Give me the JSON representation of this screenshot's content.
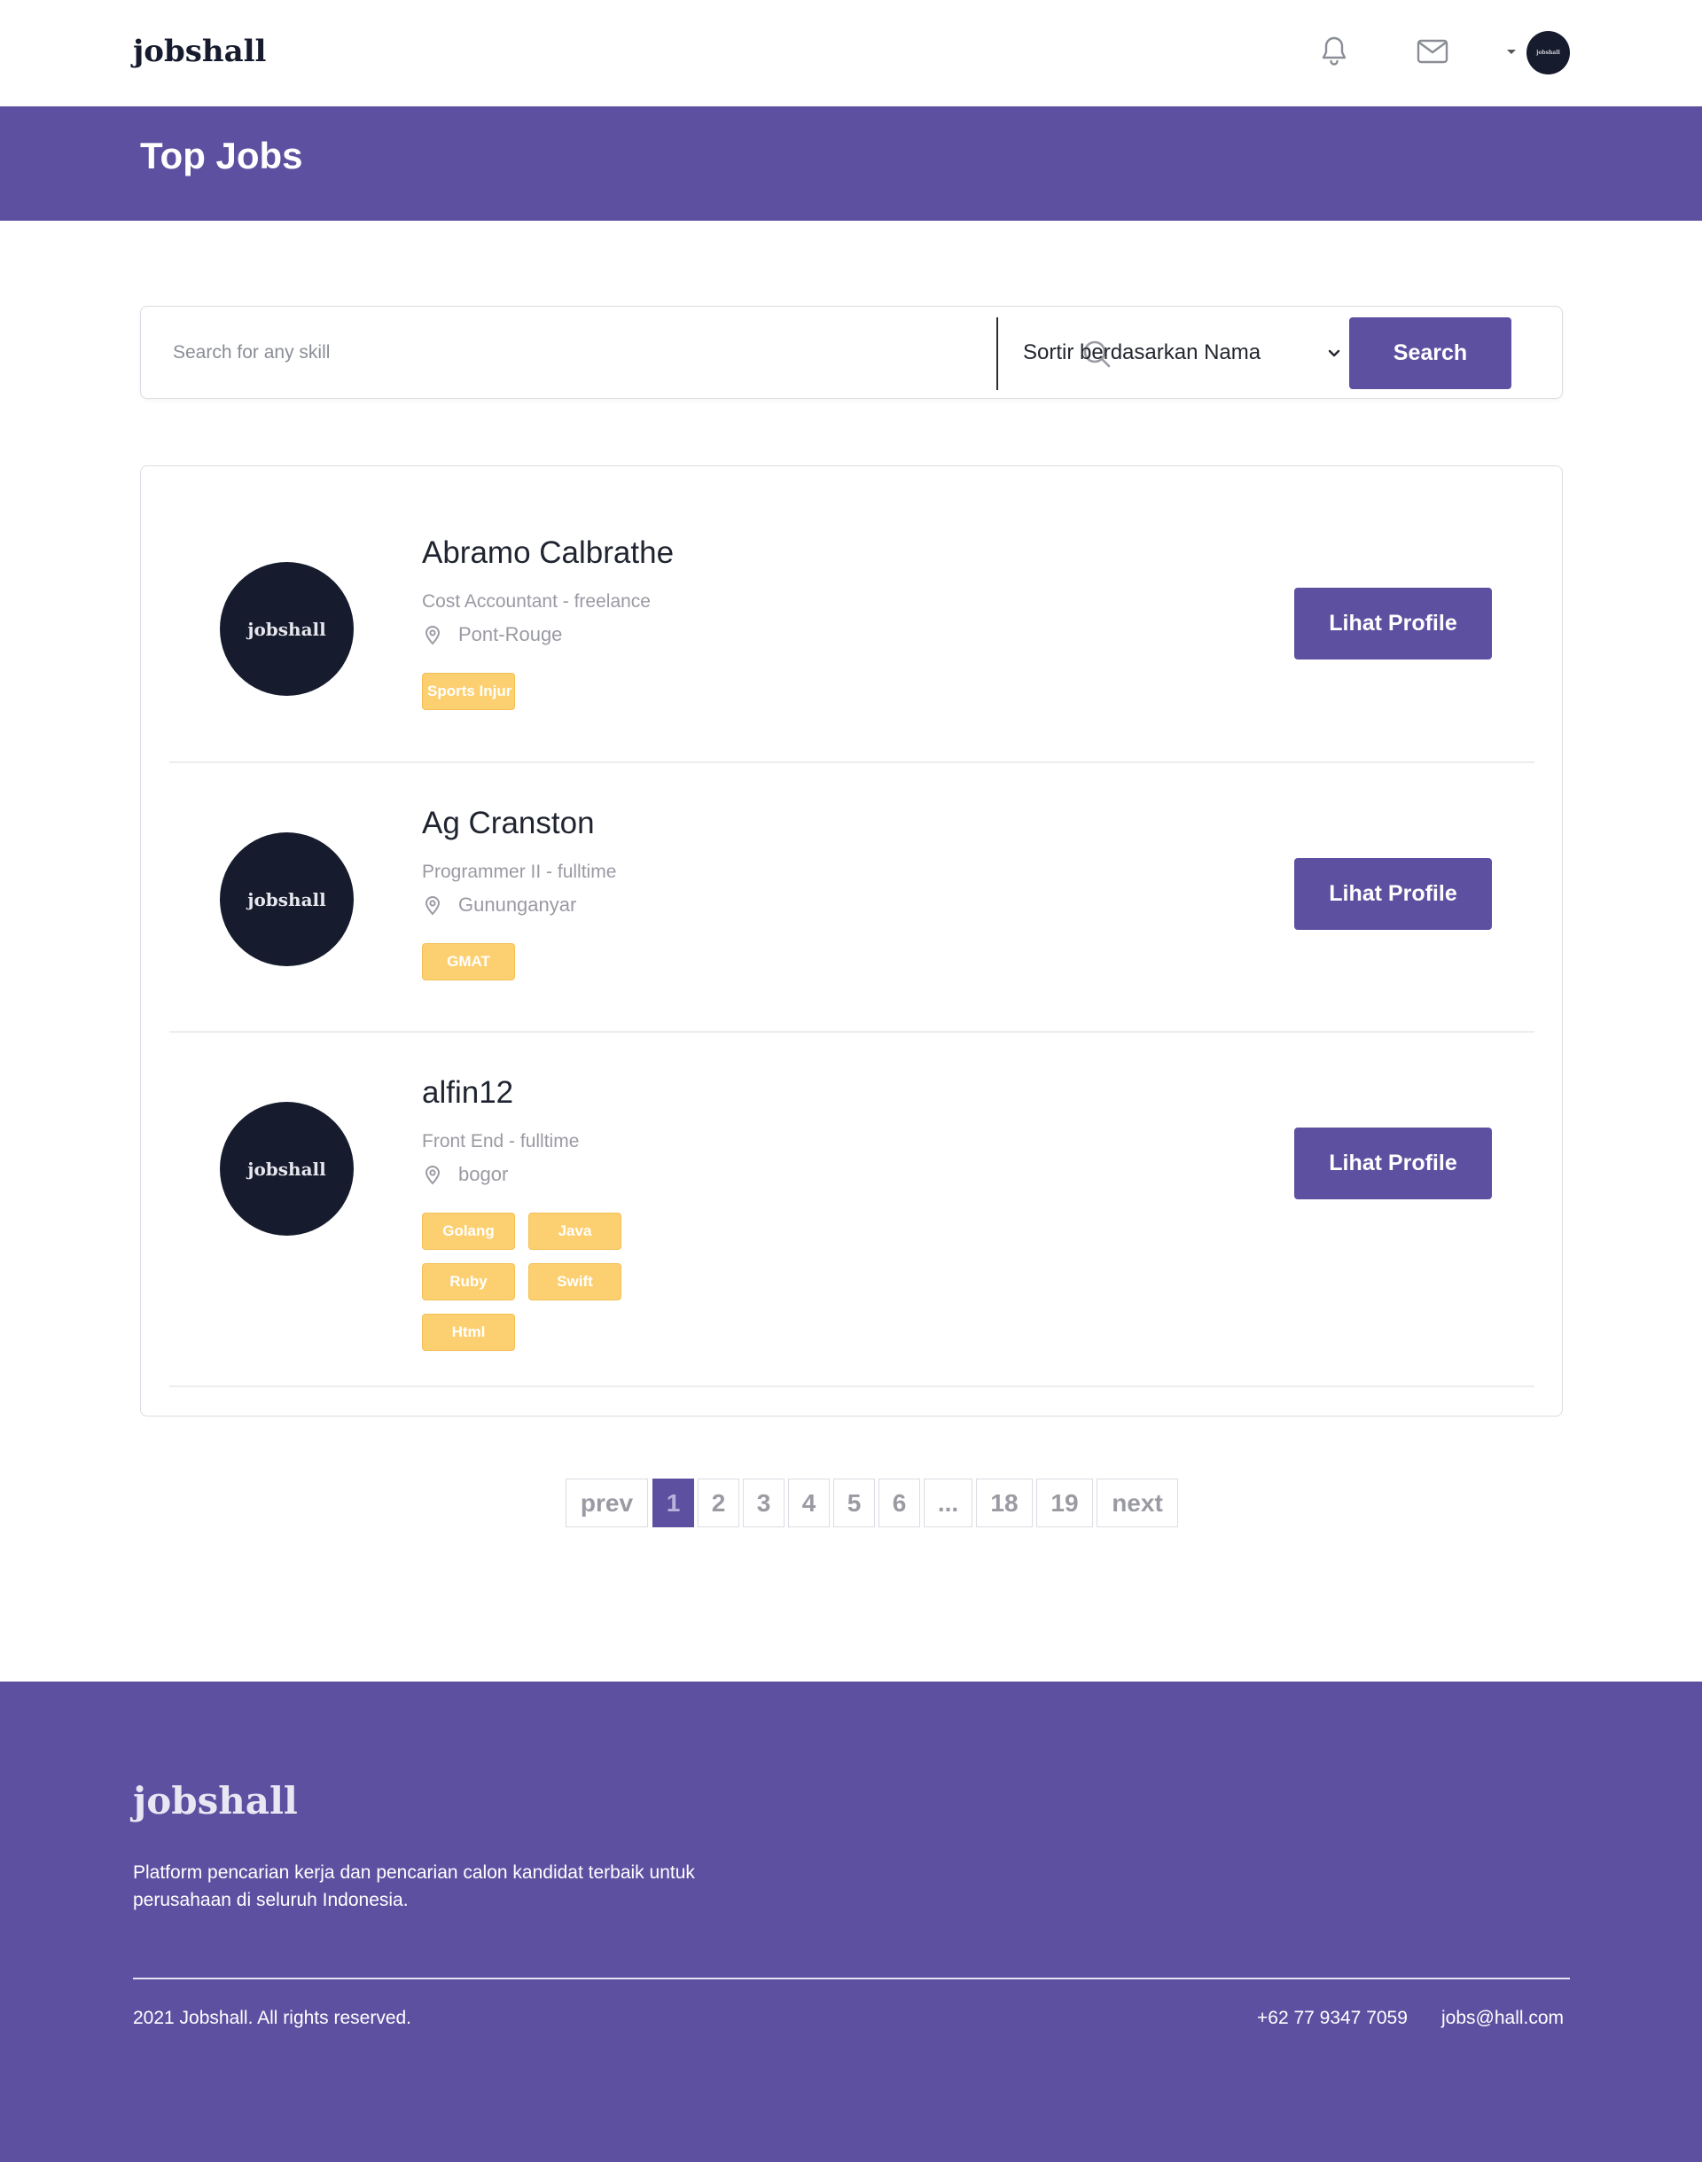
{
  "navbar": {
    "brand": "jobshall",
    "avatar_text": "jobshall"
  },
  "header": {
    "title": "Top Jobs"
  },
  "search": {
    "placeholder": "Search for any skill",
    "sort_label": "Sortir berdasarkan Nama",
    "button_label": "Search"
  },
  "candidates": [
    {
      "avatar_text": "jobshall",
      "name": "Abramo Calbrathe",
      "job": "Cost Accountant - freelance",
      "location": "Pont-Rouge",
      "skills": [
        "Sports Injur"
      ],
      "button_label": "Lihat Profile"
    },
    {
      "avatar_text": "jobshall",
      "name": "Ag Cranston",
      "job": "Programmer II - fulltime",
      "location": "Gununganyar",
      "skills": [
        "GMAT"
      ],
      "button_label": "Lihat Profile"
    },
    {
      "avatar_text": "jobshall",
      "name": "alfin12",
      "job": "Front End - fulltime",
      "location": "bogor",
      "skills": [
        "Golang",
        "Java",
        "Ruby",
        "Swift",
        "Html"
      ],
      "button_label": "Lihat Profile"
    }
  ],
  "pagination": {
    "prev": "prev",
    "pages": [
      "1",
      "2",
      "3",
      "4",
      "5",
      "6",
      "...",
      "18",
      "19"
    ],
    "next": "next",
    "current": "1"
  },
  "footer": {
    "brand": "jobshall",
    "description": "Platform pencarian kerja dan pencarian calon kandidat terbaik untuk perusahaan di seluruh Indonesia.",
    "copyright": "2021 Jobshall. All rights reserved.",
    "phone": "+62 77 9347 7059",
    "email": "jobs@hall.com"
  },
  "colors": {
    "primary": "#5e50a1",
    "dark": "#161b2e",
    "skill_badge": "#fcd071"
  }
}
